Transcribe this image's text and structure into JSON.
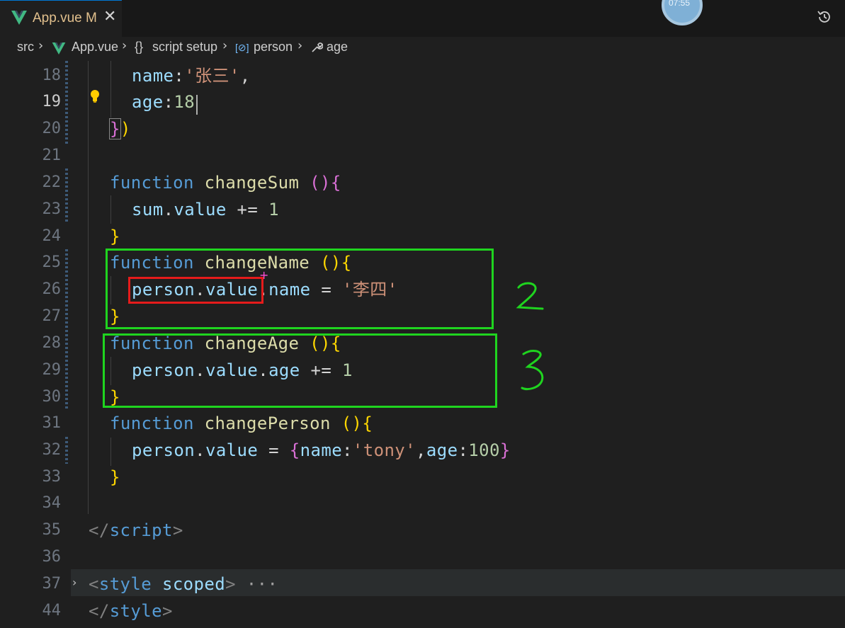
{
  "tab": {
    "filename": "App.vue",
    "modified_flag": "M",
    "close": "✕"
  },
  "avatar_text": "07:55",
  "breadcrumb": {
    "src": "src",
    "file": "App.vue",
    "script_icon": "{}",
    "script": "script setup",
    "person_icon": "[⊘]",
    "person": "person",
    "age": "age",
    "sep": "›"
  },
  "lines": {
    "l18": {
      "num": "18",
      "key": "name",
      "colon": ":",
      "str": "'张三'",
      "comma": ","
    },
    "l19": {
      "num": "19",
      "key": "age",
      "colon": ":",
      "val": "18"
    },
    "l20": {
      "num": "20",
      "brace": "}",
      "paren": ")"
    },
    "l21": {
      "num": "21"
    },
    "l22": {
      "num": "22",
      "kw": "function",
      "fn": "changeSum",
      "paren": " ()",
      "brace": "{"
    },
    "l23": {
      "num": "23",
      "obj": "sum",
      "dot": ".",
      "prop": "value",
      "op": " += ",
      "val": "1"
    },
    "l24": {
      "num": "24",
      "brace": "}"
    },
    "l25": {
      "num": "25",
      "kw": "function",
      "fn": "changeName",
      "paren": " ()",
      "brace": "{"
    },
    "l26": {
      "num": "26",
      "obj": "person",
      "dot": ".",
      "prop": "value",
      "dot2": ".",
      "prop2": "name",
      "op": " = ",
      "str": "'李四'"
    },
    "l27": {
      "num": "27",
      "brace": "}"
    },
    "l28": {
      "num": "28",
      "kw": "function",
      "fn": "changeAge",
      "paren": " ()",
      "brace": "{"
    },
    "l29": {
      "num": "29",
      "obj": "person",
      "dot": ".",
      "prop": "value",
      "dot2": ".",
      "prop2": "age",
      "op": " += ",
      "val": "1"
    },
    "l30": {
      "num": "30",
      "brace": "}"
    },
    "l31": {
      "num": "31",
      "kw": "function",
      "fn": "changePerson",
      "paren": " ()",
      "brace": "{"
    },
    "l32": {
      "num": "32",
      "obj": "person",
      "dot": ".",
      "prop": "value",
      "op": " = ",
      "brace_open": "{",
      "k1": "name",
      "c1": ":",
      "s1": "'tony'",
      "comma": ",",
      "k2": "age",
      "c2": ":",
      "v2": "100",
      "brace_close": "}"
    },
    "l33": {
      "num": "33",
      "brace": "}"
    },
    "l34": {
      "num": "34"
    },
    "l35": {
      "num": "35",
      "open": "</",
      "tag": "script",
      "close": ">"
    },
    "l36": {
      "num": "36"
    },
    "l37": {
      "num": "37",
      "open": "<",
      "tag": "style",
      "attr": "scoped",
      "close": ">",
      "ellipsis": "···"
    },
    "l44": {
      "num": "44",
      "open": "</",
      "tag": "style",
      "close": ">"
    }
  },
  "annotations": {
    "box_2": "2",
    "box_3": "3"
  },
  "colors": {
    "green_box": "#1fd41f",
    "red_box": "#e51b1b",
    "keyword": "#569cd6",
    "function": "#dcdcaa",
    "string": "#ce9178",
    "number": "#b5cea8"
  }
}
